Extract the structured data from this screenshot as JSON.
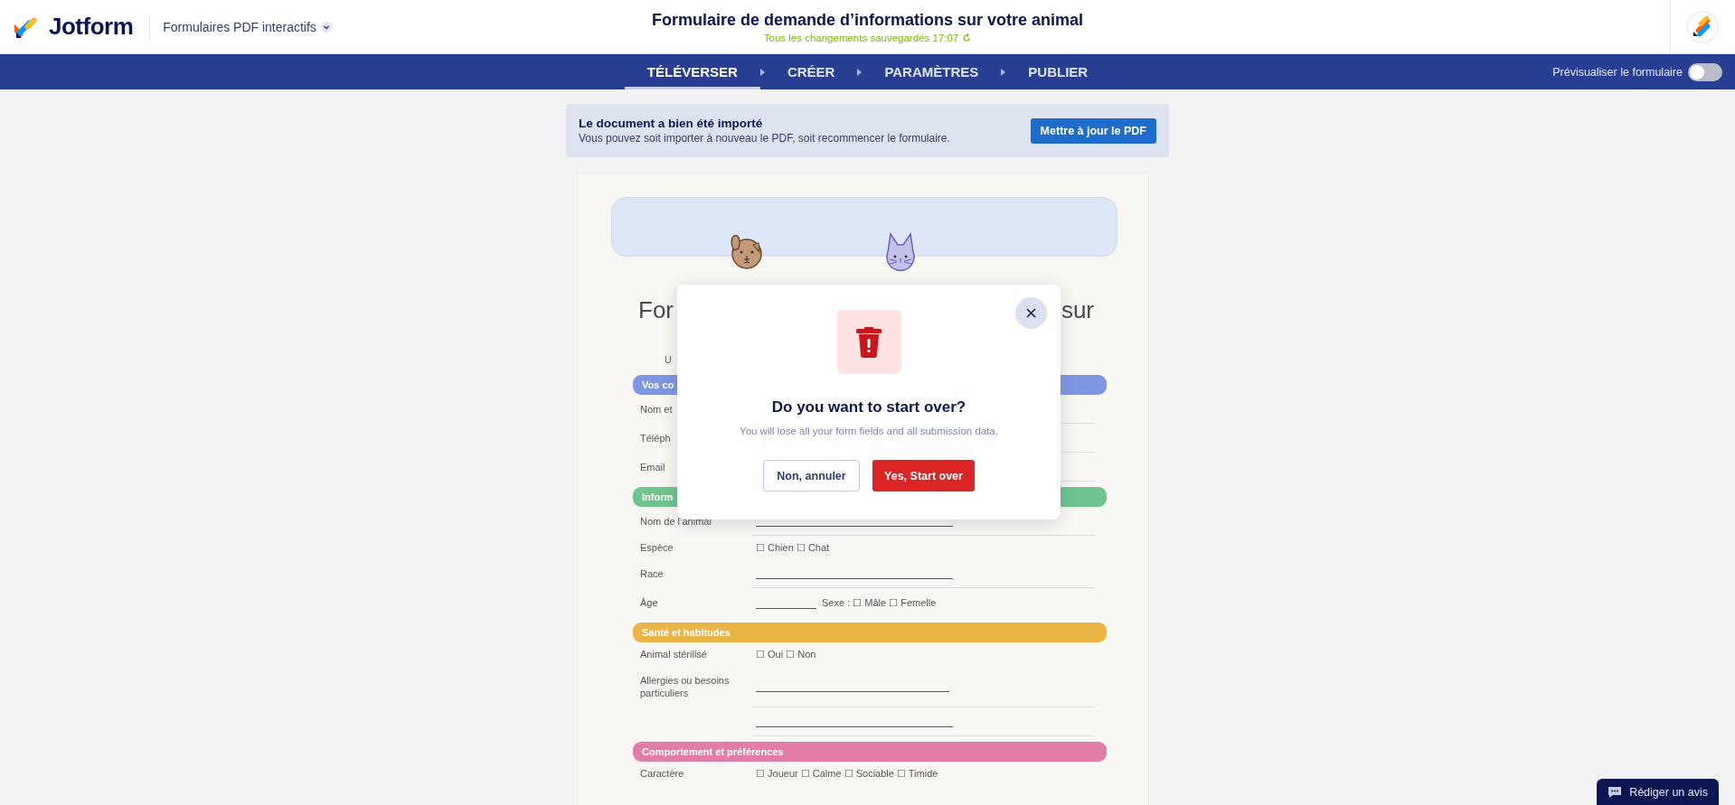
{
  "header": {
    "brand": "Jotform",
    "workspace": "Formulaires PDF interactifs",
    "title": "Formulaire de demande d’informations sur votre animal",
    "save_status": "Tous les changements sauvegardés 17:07"
  },
  "nav": {
    "tabs": [
      {
        "label": "TÉLÉVERSER",
        "selected": true
      },
      {
        "label": "CRÉER",
        "selected": false
      },
      {
        "label": "PARAMÈTRES",
        "selected": false
      },
      {
        "label": "PUBLIER",
        "selected": false
      }
    ],
    "preview": {
      "label": "Prévisualiser le formulaire",
      "on": false
    }
  },
  "notice": {
    "title": "Le document a bien été importé",
    "text": "Vous pouvez soit importer à nouveau le PDF, soit recommencer le formulaire.",
    "button": "Mettre à jour le PDF"
  },
  "form": {
    "title_left": "For",
    "title_right": "sur",
    "subtitle": "U",
    "sections": [
      {
        "title": "Vos co",
        "color": "#7f97e2",
        "rows": [
          {
            "kind": "covered",
            "label": "Nom et"
          },
          {
            "kind": "covered",
            "label": "Téléph"
          },
          {
            "kind": "covered",
            "label": "Email"
          }
        ]
      },
      {
        "title": "Inform",
        "color": "#6fc490",
        "rows": [
          {
            "kind": "line",
            "label": "Nom de l’animal"
          },
          {
            "kind": "text",
            "label": "Espèce",
            "value": "☐ Chien ☐ Chat"
          },
          {
            "kind": "line",
            "label": "Race"
          },
          {
            "kind": "line_text",
            "label": "Âge",
            "value": "Sexe : ☐ Mâle ☐ Femelle"
          }
        ]
      },
      {
        "title": "Santé et habitudes",
        "color": "#eab545",
        "rows": [
          {
            "kind": "text",
            "label": "Animal stérilisé",
            "value": "☐ Oui ☐ Non"
          },
          {
            "kind": "tall_line",
            "label": "Allergies ou besoins particuliers"
          },
          {
            "kind": "line"
          }
        ]
      },
      {
        "title": "Comportement et préférences",
        "color": "#e27ca8",
        "rows": [
          {
            "kind": "text",
            "label": "Caractère",
            "value": "☐ Joueur ☐ Calme ☐ Sociable ☐ Timide"
          }
        ]
      }
    ]
  },
  "dialog": {
    "title": "Do you want to start over?",
    "message": "You will lose all your form fields and all submission data.",
    "cancel": "Non, annuler",
    "confirm": "Yes, Start over"
  },
  "feedback_button": "Rédiger un avis"
}
